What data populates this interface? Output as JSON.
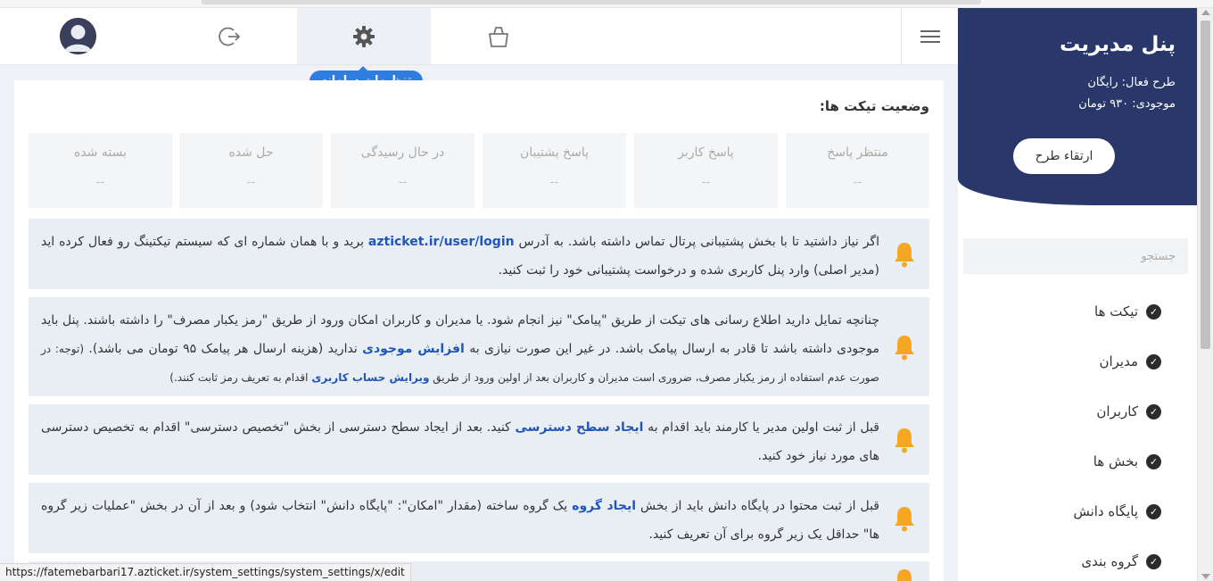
{
  "sidebar": {
    "title": "پنل مدیریت",
    "plan_line": "طرح فعال: رایگان",
    "balance_line": "موجودی: ۹۳۰ تومان",
    "upgrade_label": "ارتقاء طرح",
    "search_placeholder": "جستجو",
    "menu": [
      {
        "label": "تیکت ها"
      },
      {
        "label": "مدیران"
      },
      {
        "label": "کاربران"
      },
      {
        "label": "بخش ها"
      },
      {
        "label": "پایگاه دانش"
      },
      {
        "label": "گروه بندی"
      }
    ]
  },
  "topnav": {
    "tooltip": "تنظیمات سامانه",
    "icons": [
      "hamburger-icon",
      "shopping-bag-icon",
      "gear-icon",
      "logout-icon",
      "user-avatar"
    ]
  },
  "tickets": {
    "title": "وضعیت تیکت ها:",
    "stats": [
      {
        "label": "منتظر پاسخ",
        "value": "--"
      },
      {
        "label": "پاسخ کاربر",
        "value": "--"
      },
      {
        "label": "پاسخ پشتیبان",
        "value": "--"
      },
      {
        "label": "در حال رسیدگی",
        "value": "--"
      },
      {
        "label": "حل شده",
        "value": "--"
      },
      {
        "label": "بسته شده",
        "value": "--"
      }
    ]
  },
  "notes": {
    "n1": {
      "a": "اگر نیاز داشتید تا با بخش پشتیبانی پرتال تماس داشته باشد. به آدرس ",
      "link": "azticket.ir/user/login",
      "b": " برید و با همان شماره ای که سیستم تیکتینگ رو فعال کرده اید (مدیر اصلی) وارد پنل کاربری شده و درخواست پشتیبانی خود را ثبت کنید."
    },
    "n2": {
      "a": "چنانچه تمایل دارید اطلاع رسانی های تیکت از طریق \"پیامک\" نیز انجام شود. یا مدیران و کاربران امکان ورود از طریق \"رمز یکبار مصرف\" را داشته باشند. پنل باید موجودی داشته باشد تا قادر به ارسال پیامک باشد. در غیر این صورت نیازی به ",
      "link": "افزایش موجودی",
      "b": " ندارید (هزینه ارسال هر پیامک ۹۵ تومان می باشد). ",
      "small_a": "(توجه: در صورت عدم استفاده از رمز یکبار مصرف، ضروری است مدیران و کاربران بعد از اولین ورود از طریق ",
      "small_link": "ویرایش حساب کاربری",
      "small_b": " اقدام به تعریف رمز ثابت کنند.)"
    },
    "n3": {
      "a": "قبل از ثبت اولین مدیر یا کارمند باید اقدام به ",
      "link": "ایجاد سطح دسترسی",
      "b": " کنید. بعد از ایجاد سطح دسترسی از بخش \"تخصیص دسترسی\" اقدام به تخصیص دسترسی های مورد نیاز خود کنید."
    },
    "n4": {
      "a": "قبل از ثبت محتوا در پایگاه دانش باید از بخش ",
      "link": "ایجاد گروه",
      "b": " یک گروه ساخته (مقدار \"امکان\": \"پایگاه دانش\" انتخاب شود) و بعد از آن در بخش \"عملیات زیر گروه ها\" حداقل یک زیر گروه برای آن تعریف کنید."
    }
  },
  "statusbar": {
    "url": "https://fatemebarbari17.azticket.ir/system_settings/system_settings/x/edit"
  },
  "colors": {
    "sidebar_header": "#29376a",
    "tooltip": "#2f7de1",
    "underline": "#d61a2a",
    "bell": "#f5a623",
    "link": "#1f56b8"
  }
}
